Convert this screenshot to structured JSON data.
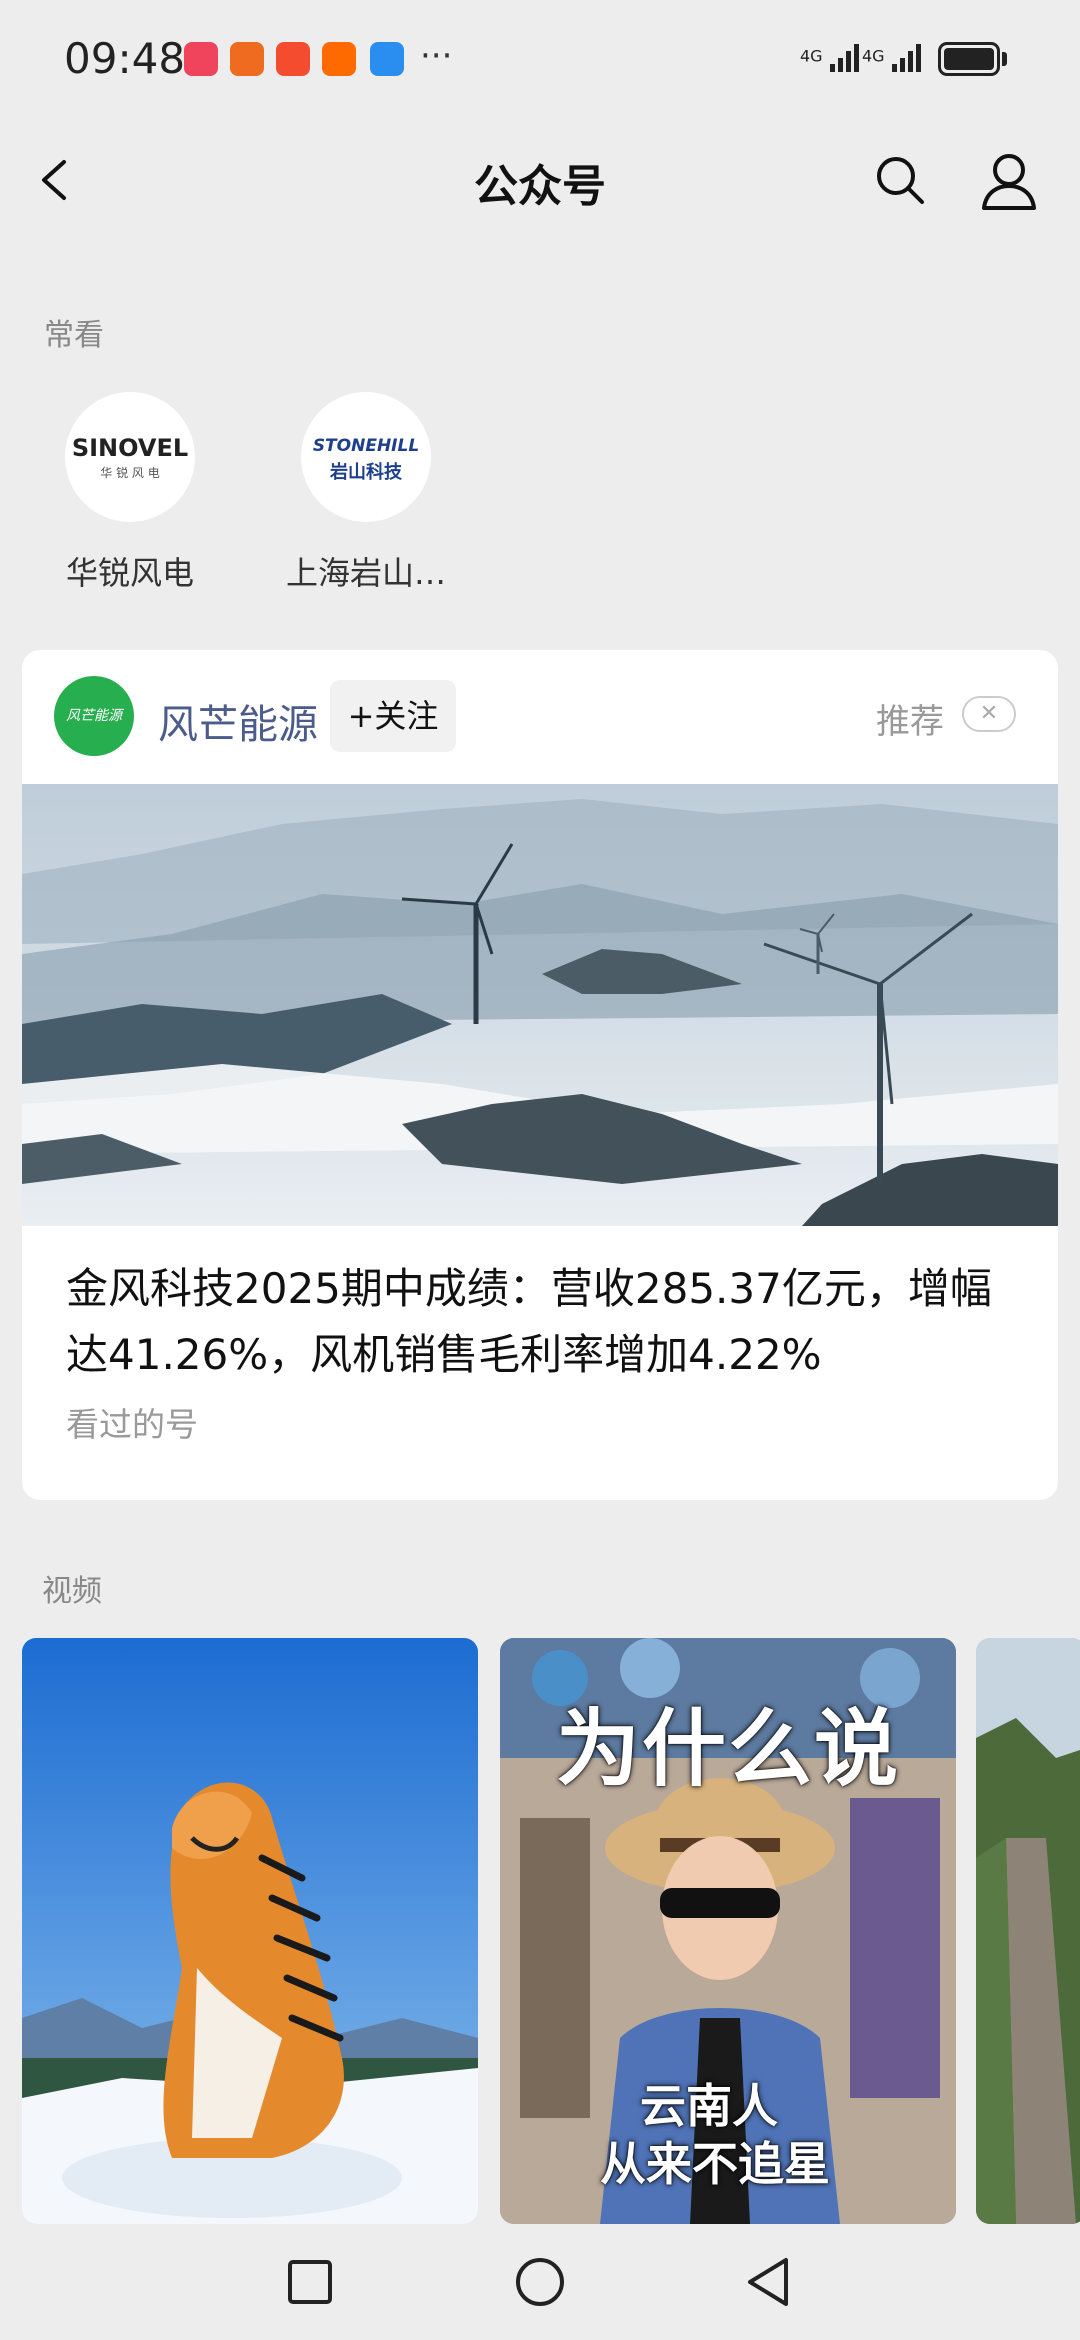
{
  "status_bar": {
    "time": "09:48",
    "dots": "···",
    "signal1": "4G",
    "signal2": "4G"
  },
  "nav": {
    "title": "公众号"
  },
  "frequent": {
    "label": "常看",
    "items": [
      {
        "name": "华锐风电",
        "logo_main": "SINOVEL",
        "logo_sub": "华 锐 风 电"
      },
      {
        "name": "上海岩山…",
        "logo_main": "STONEHILL",
        "logo_sub": "岩山科技"
      }
    ]
  },
  "card": {
    "account_name": "风芒能源",
    "avatar_text": "风芒能源",
    "follow_label": "+关注",
    "recommend_label": "推荐",
    "close_label": "✕",
    "title": "金风科技2025期中成绩：营收285.37亿元，增幅达41.26%，风机销售毛利率增加4.22%",
    "subtitle": "看过的号"
  },
  "videos": {
    "label": "视频",
    "items": [
      {
        "caption": ""
      },
      {
        "caption_top": "为什么说",
        "caption_bottom_1": "云南人",
        "caption_bottom_2": "从来不追星"
      },
      {
        "caption": ""
      }
    ]
  }
}
